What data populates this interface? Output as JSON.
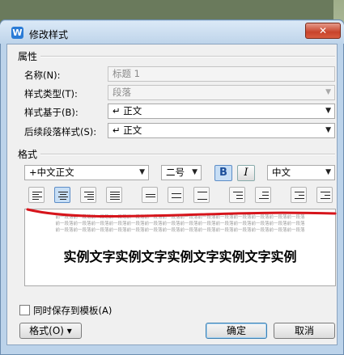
{
  "window": {
    "title": "修改样式",
    "close_glyph": "✕",
    "app_icon": "W"
  },
  "properties": {
    "group_label": "属性",
    "name_label": "名称(N):",
    "name_value": "标题 1",
    "type_label": "样式类型(T):",
    "type_value": "段落",
    "based_on_label": "样式基于(B):",
    "based_on_value": "↵ 正文",
    "next_label": "后续段落样式(S):",
    "next_value": "↵ 正文"
  },
  "format": {
    "group_label": "格式",
    "font_value": "+中文正文",
    "size_value": "二号",
    "bold_label": "B",
    "italic_label": "I",
    "script_value": "中文"
  },
  "preview": {
    "sample_small": "前一段落前一段落前一段落前一段落前一段落前一段落前一段落前一段落前一段落前一段落前一段落前一段落前一段落前一段落",
    "sample_text": "实例文字实例文字实例文字实例文字实例"
  },
  "footer": {
    "save_to_template_label": "同时保存到模板(A)",
    "format_button_label": "格式(O) ▾",
    "ok_label": "确定",
    "cancel_label": "取消"
  }
}
